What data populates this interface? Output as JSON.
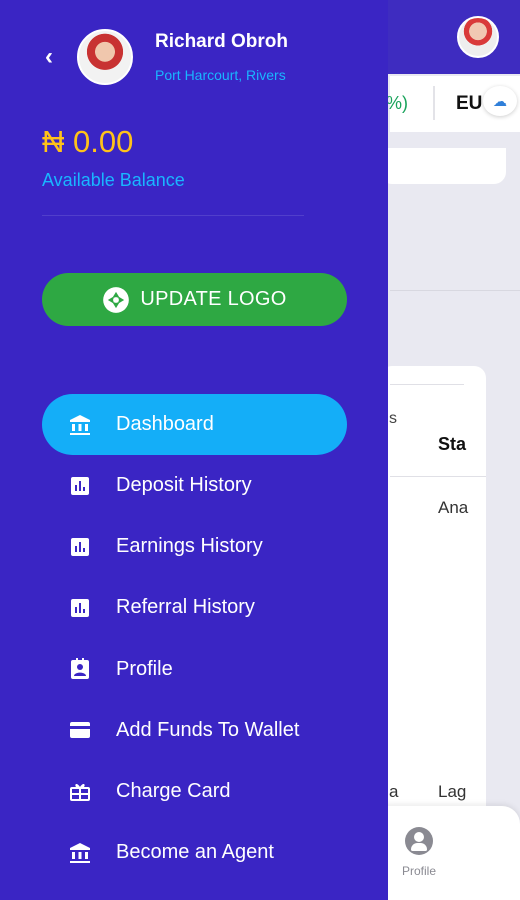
{
  "background": {
    "ticker_percent": "%)",
    "ticker_currency": "EU",
    "table_header_small": "s",
    "table_header": "Sta",
    "table_cell": "Ana",
    "table_cell_2a": "a",
    "table_cell_2b": "Lag",
    "nav_profile_label": "Profile"
  },
  "user": {
    "name": "Richard Obroh",
    "location": "Port Harcourt, Rivers"
  },
  "wallet": {
    "balance": "₦ 0.00",
    "balance_label": "Available Balance"
  },
  "update_logo_label": "UPDATE LOGO",
  "menu": [
    {
      "label": "Dashboard",
      "icon": "bank-icon",
      "active": true
    },
    {
      "label": "Deposit History",
      "icon": "chart-icon",
      "active": false
    },
    {
      "label": "Earnings History",
      "icon": "chart-icon",
      "active": false
    },
    {
      "label": "Referral History",
      "icon": "chart-icon",
      "active": false
    },
    {
      "label": "Profile",
      "icon": "id-badge-icon",
      "active": false
    },
    {
      "label": "Add Funds To Wallet",
      "icon": "credit-card-icon",
      "active": false
    },
    {
      "label": "Charge Card",
      "icon": "gift-card-icon",
      "active": false
    },
    {
      "label": "Become an Agent",
      "icon": "bank-icon",
      "active": false
    }
  ],
  "colors": {
    "drawer_bg": "#3a25c4",
    "active_item": "#14aef8",
    "update_button": "#2ea843",
    "balance": "#ffc21a",
    "accent_text": "#19b6ff"
  }
}
